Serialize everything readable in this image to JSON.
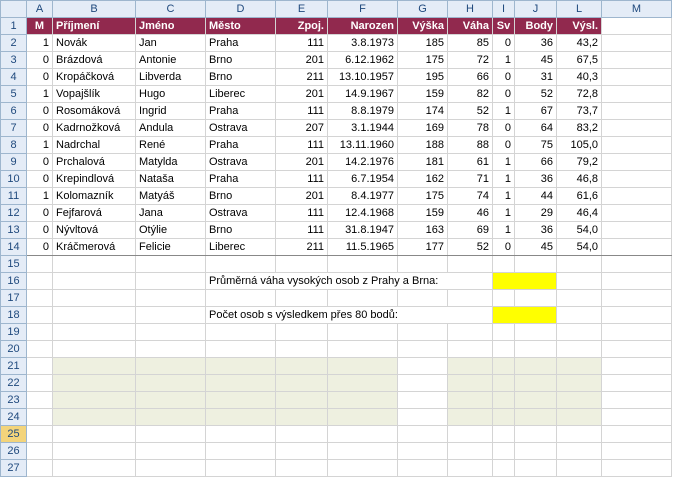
{
  "columns": [
    "A",
    "B",
    "C",
    "D",
    "E",
    "F",
    "G",
    "H",
    "I",
    "J",
    "L",
    "M"
  ],
  "header": {
    "A": "M",
    "B": "Příjmení",
    "C": "Jméno",
    "D": "Město",
    "E": "Zpoj.",
    "F": "Narozen",
    "G": "Výška",
    "H": "Váha",
    "I": "Sv",
    "J": "Body",
    "L": "Výsl."
  },
  "rows": [
    {
      "n": 2,
      "M": "1",
      "pr": "Novák",
      "jm": "Jan",
      "me": "Praha",
      "zp": "111",
      "na": "3.8.1973",
      "vy": "185",
      "va": "85",
      "sv": "0",
      "bo": "36",
      "vysl": "43,2"
    },
    {
      "n": 3,
      "M": "0",
      "pr": "Brázdová",
      "jm": "Antonie",
      "me": "Brno",
      "zp": "201",
      "na": "6.12.1962",
      "vy": "175",
      "va": "72",
      "sv": "1",
      "bo": "45",
      "vysl": "67,5"
    },
    {
      "n": 4,
      "M": "0",
      "pr": "Kropáčková",
      "jm": "Libverda",
      "me": "Brno",
      "zp": "211",
      "na": "13.10.1957",
      "vy": "195",
      "va": "66",
      "sv": "0",
      "bo": "31",
      "vysl": "40,3"
    },
    {
      "n": 5,
      "M": "1",
      "pr": "Vopajšlík",
      "jm": "Hugo",
      "me": "Liberec",
      "zp": "201",
      "na": "14.9.1967",
      "vy": "159",
      "va": "82",
      "sv": "0",
      "bo": "52",
      "vysl": "72,8"
    },
    {
      "n": 6,
      "M": "0",
      "pr": "Rosomáková",
      "jm": "Ingrid",
      "me": "Praha",
      "zp": "111",
      "na": "8.8.1979",
      "vy": "174",
      "va": "52",
      "sv": "1",
      "bo": "67",
      "vysl": "73,7"
    },
    {
      "n": 7,
      "M": "0",
      "pr": "Kadrnožková",
      "jm": "Andula",
      "me": "Ostrava",
      "zp": "207",
      "na": "3.1.1944",
      "vy": "169",
      "va": "78",
      "sv": "0",
      "bo": "64",
      "vysl": "83,2"
    },
    {
      "n": 8,
      "M": "1",
      "pr": "Nadrchal",
      "jm": "René",
      "me": "Praha",
      "zp": "111",
      "na": "13.11.1960",
      "vy": "188",
      "va": "88",
      "sv": "0",
      "bo": "75",
      "vysl": "105,0"
    },
    {
      "n": 9,
      "M": "0",
      "pr": "Prchalová",
      "jm": "Matylda",
      "me": "Ostrava",
      "zp": "201",
      "na": "14.2.1976",
      "vy": "181",
      "va": "61",
      "sv": "1",
      "bo": "66",
      "vysl": "79,2"
    },
    {
      "n": 10,
      "M": "0",
      "pr": "Krepindlová",
      "jm": "Nataša",
      "me": "Praha",
      "zp": "111",
      "na": "6.7.1954",
      "vy": "162",
      "va": "71",
      "sv": "1",
      "bo": "36",
      "vysl": "46,8"
    },
    {
      "n": 11,
      "M": "1",
      "pr": "Kolomazník",
      "jm": "Matyáš",
      "me": "Brno",
      "zp": "201",
      "na": "8.4.1977",
      "vy": "175",
      "va": "74",
      "sv": "1",
      "bo": "44",
      "vysl": "61,6"
    },
    {
      "n": 12,
      "M": "0",
      "pr": "Fejfarová",
      "jm": "Jana",
      "me": "Ostrava",
      "zp": "111",
      "na": "12.4.1968",
      "vy": "159",
      "va": "46",
      "sv": "1",
      "bo": "29",
      "vysl": "46,4"
    },
    {
      "n": 13,
      "M": "0",
      "pr": "Nývltová",
      "jm": "Otýlie",
      "me": "Brno",
      "zp": "111",
      "na": "31.8.1947",
      "vy": "163",
      "va": "69",
      "sv": "1",
      "bo": "36",
      "vysl": "54,0"
    },
    {
      "n": 14,
      "M": "0",
      "pr": "Kráčmerová",
      "jm": "Felicie",
      "me": "Liberec",
      "zp": "211",
      "na": "11.5.1965",
      "vy": "177",
      "va": "52",
      "sv": "0",
      "bo": "45",
      "vysl": "54,0"
    }
  ],
  "label16": "Průměrná váha vysokých osob z Prahy a Brna:",
  "label18": "Počet osob s výsledkem přes 80 bodů:",
  "rownums_extra": [
    15,
    16,
    17,
    18,
    19,
    20,
    21,
    22,
    23,
    24,
    25,
    26,
    27
  ]
}
